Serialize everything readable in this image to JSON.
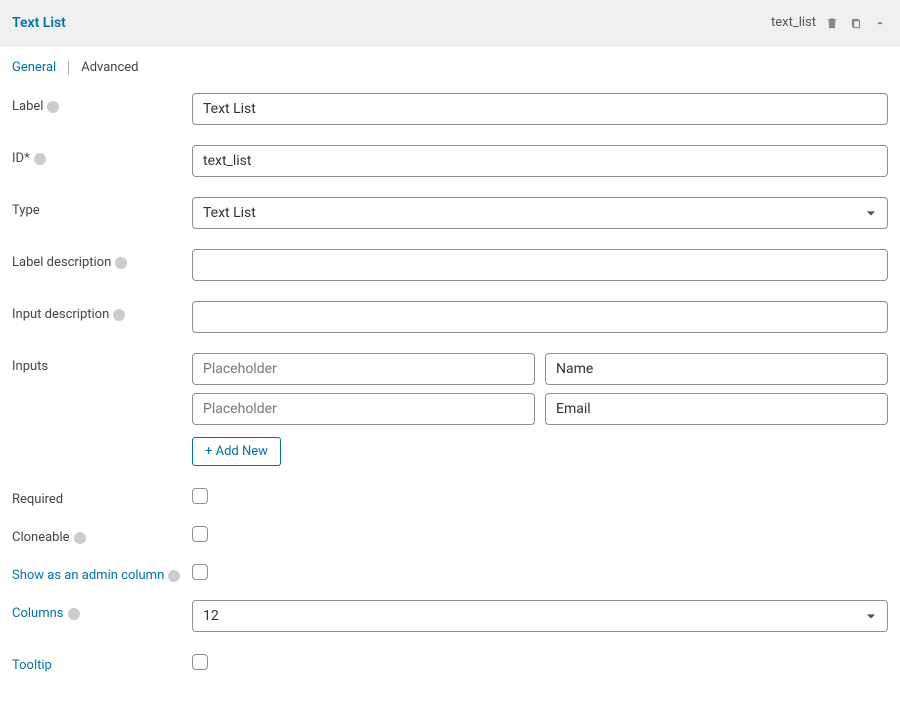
{
  "header": {
    "title": "Text List",
    "slug": "text_list"
  },
  "tabs": {
    "general": "General",
    "advanced": "Advanced"
  },
  "fields": {
    "label": {
      "label": "Label",
      "value": "Text List"
    },
    "id": {
      "label": "ID*",
      "value": "text_list"
    },
    "type": {
      "label": "Type",
      "value": "Text List"
    },
    "label_description": {
      "label": "Label description",
      "value": ""
    },
    "input_description": {
      "label": "Input description",
      "value": ""
    },
    "inputs": {
      "label": "Inputs",
      "placeholder_text": "Placeholder",
      "rows": [
        {
          "placeholder": "",
          "name": "Name"
        },
        {
          "placeholder": "",
          "name": "Email"
        }
      ],
      "add_new": "+ Add New"
    },
    "required": {
      "label": "Required"
    },
    "cloneable": {
      "label": "Cloneable"
    },
    "admin_column": {
      "label": "Show as an admin column"
    },
    "columns": {
      "label": "Columns",
      "value": "12"
    },
    "tooltip": {
      "label": "Tooltip"
    }
  }
}
